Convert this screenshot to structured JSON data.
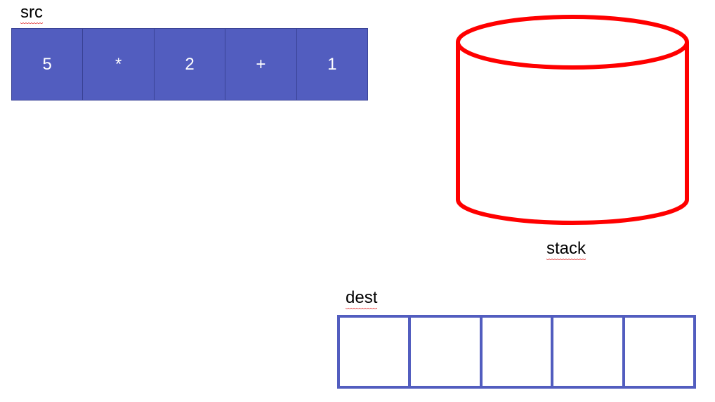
{
  "src": {
    "label": "src",
    "cells": [
      "5",
      "*",
      "2",
      "+",
      "1"
    ],
    "fill_color": "#525dbf",
    "text_color": "#ffffff"
  },
  "stack": {
    "label": "stack",
    "stroke_color": "#ff0000",
    "shape": "cylinder"
  },
  "dest": {
    "label": "dest",
    "cells": [
      "",
      "",
      "",
      "",
      ""
    ],
    "border_color": "#525dbf"
  }
}
